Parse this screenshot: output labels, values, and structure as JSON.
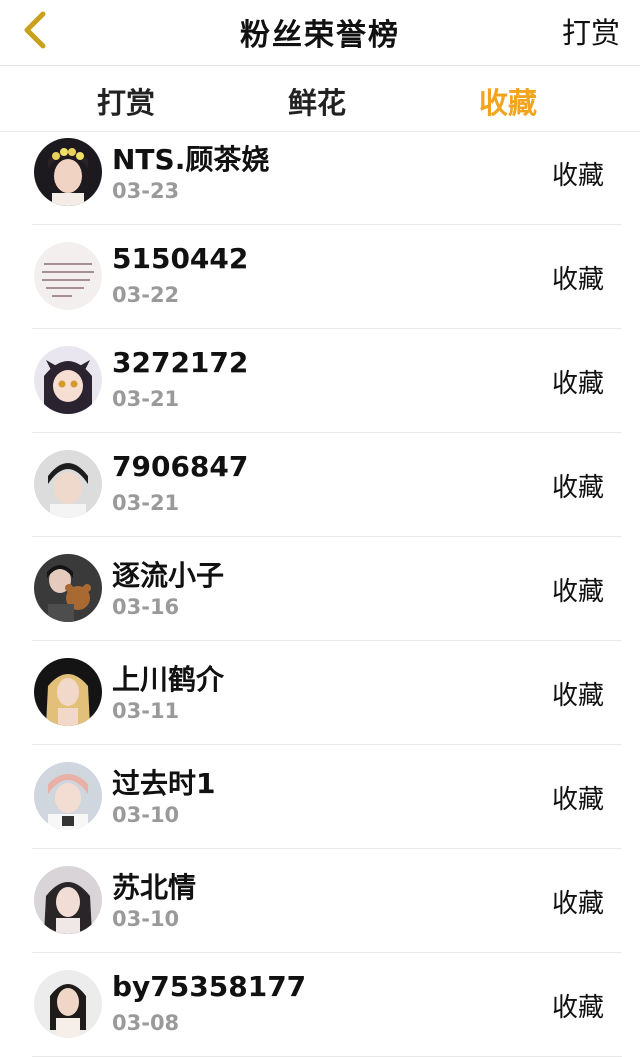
{
  "nav": {
    "title": "粉丝荣誉榜",
    "right_action": "打赏",
    "back_icon": "chevron-left-icon",
    "back_color": "#c9a11d"
  },
  "tabs": [
    {
      "label": "打赏",
      "active": false
    },
    {
      "label": "鲜花",
      "active": false
    },
    {
      "label": "收藏",
      "active": true
    }
  ],
  "accent_color": "#f2a41e",
  "fans": [
    {
      "name": "NTS.顾茶娆",
      "date": "03-23",
      "action": "收藏"
    },
    {
      "name": "5150442",
      "date": "03-22",
      "action": "收藏"
    },
    {
      "name": "3272172",
      "date": "03-21",
      "action": "收藏"
    },
    {
      "name": "7906847",
      "date": "03-21",
      "action": "收藏"
    },
    {
      "name": "逐流小子",
      "date": "03-16",
      "action": "收藏"
    },
    {
      "name": "上川鹤介",
      "date": "03-11",
      "action": "收藏"
    },
    {
      "name": "过去时1",
      "date": "03-10",
      "action": "收藏"
    },
    {
      "name": "苏北情",
      "date": "03-10",
      "action": "收藏"
    },
    {
      "name": "by75358177",
      "date": "03-08",
      "action": "收藏"
    }
  ]
}
